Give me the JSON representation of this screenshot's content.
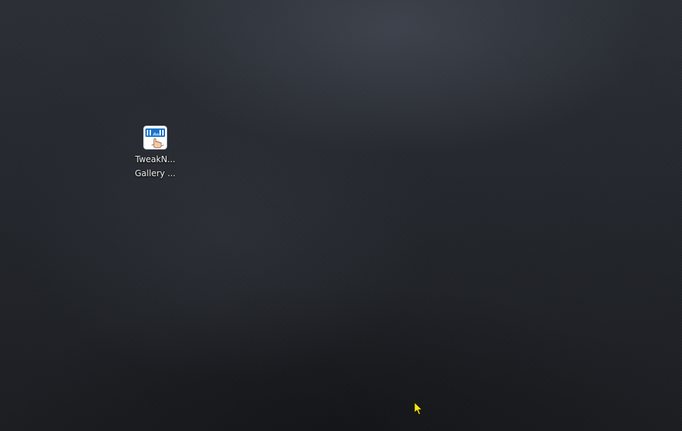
{
  "desktop": {
    "icons": [
      {
        "label_line1": "TweakN...",
        "label_line2": "Gallery ...",
        "icon": "tweaknow-gallery-app-icon"
      }
    ],
    "cursor": {
      "icon": "arrow-pointer-icon",
      "color": "#f5e614"
    },
    "colors": {
      "background": "#1e2126",
      "label_text": "#f2f2f2",
      "icon_blue": "#1a73c8"
    }
  }
}
